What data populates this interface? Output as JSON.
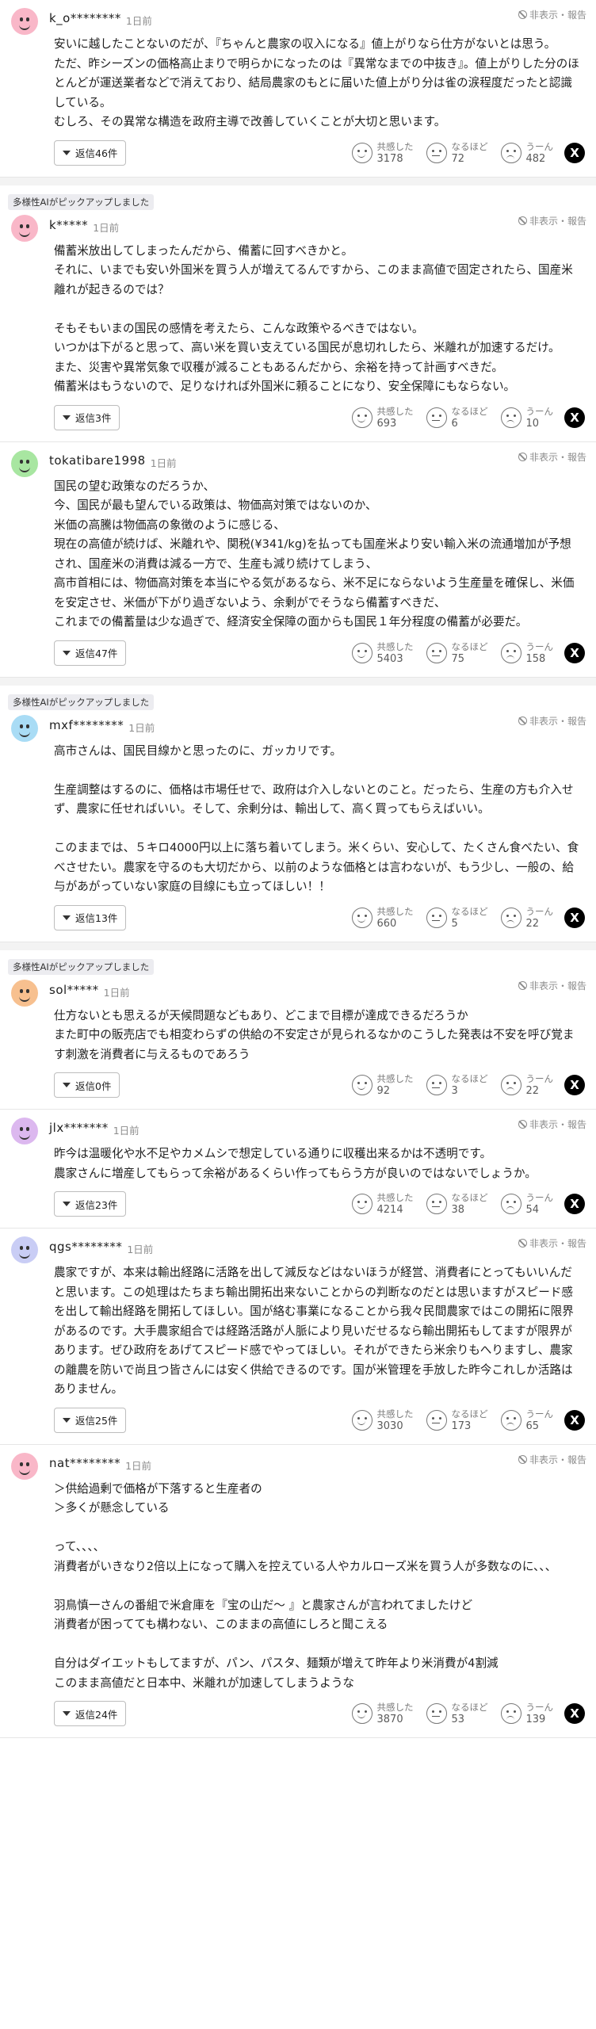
{
  "labels": {
    "report": "非表示・報告",
    "pickup_badge": "多様性AIがピックアップしました",
    "react_agree": "共感した",
    "react_insight": "なるほど",
    "react_hmm": "うーん",
    "x_share": "X"
  },
  "comments": [
    {
      "user": "k_o********",
      "time": "1日前",
      "picked": false,
      "avatar_color": "#f9b7c8",
      "lines": [
        "安いに越したことないのだが、『ちゃんと農家の収入になる』値上がりなら仕方がないとは思う。",
        "ただ、昨シーズンの価格高止まりで明らかになったのは『異常なまでの中抜き』。値上がりした分のほとんどが運送業者などで消えており、結局農家のもとに届いた値上がり分は雀の涙程度だったと認識している。",
        "むしろ、その異常な構造を政府主導で改善していくことが大切と思います。"
      ],
      "reply_label": "返信46件",
      "agree": "3178",
      "insight": "72",
      "hmm": "482"
    },
    {
      "user": "k*****",
      "time": "1日前",
      "picked": true,
      "avatar_color": "#f9b7c8",
      "lines": [
        "備蓄米放出してしまったんだから、備蓄に回すべきかと。",
        "それに、いまでも安い外国米を買う人が増えてるんですから、このまま高値で固定されたら、国産米離れが起きるのでは？",
        "",
        "そもそもいまの国民の感情を考えたら、こんな政策やるべきではない。",
        "いつかは下がると思って、高い米を買い支えている国民が息切れしたら、米離れが加速するだけ。",
        "また、災害や異常気象で収穫が減ることもあるんだから、余裕を持って計画すべきだ。",
        "備蓄米はもうないので、足りなければ外国米に頼ることになり、安全保障にもならない。"
      ],
      "reply_label": "返信3件",
      "agree": "693",
      "insight": "6",
      "hmm": "10"
    },
    {
      "user": "tokatibare1998",
      "time": "1日前",
      "picked": false,
      "avatar_color": "#a8e6a1",
      "lines": [
        "国民の望む政策なのだろうか、",
        "今、国民が最も望んでいる政策は、物価高対策ではないのか、",
        "米価の高騰は物価高の象徴のように感じる、",
        "現在の高値が続けば、米離れや、関税(¥341/kg)を払っても国産米より安い輸入米の流通増加が予想され、国産米の消費は減る一方で、生産も減り続けてしまう、",
        "高市首相には、物価高対策を本当にやる気があるなら、米不足にならないよう生産量を確保し、米価を安定させ、米価が下がり過ぎないよう、余剰がでそうなら備蓄すべきだ、",
        "これまでの備蓄量は少な過ぎで、経済安全保障の面からも国民１年分程度の備蓄が必要だ。"
      ],
      "reply_label": "返信47件",
      "agree": "5403",
      "insight": "75",
      "hmm": "158"
    },
    {
      "user": "mxf********",
      "time": "1日前",
      "picked": true,
      "avatar_color": "#a9dcf5",
      "lines": [
        "高市さんは、国民目線かと思ったのに、ガッカリです。",
        "",
        "生産調整はするのに、価格は市場任せで、政府は介入しないとのこと。だったら、生産の方も介入せず、農家に任せればいい。そして、余剰分は、輸出して、高く買ってもらえばいい。",
        "",
        "このままでは、５キロ4000円以上に落ち着いてしまう。米くらい、安心して、たくさん食べたい、食べさせたい。農家を守るのも大切だから、以前のような価格とは言わないが、もう少し、一般の、給与があがっていない家庭の目線にも立ってほしい！！"
      ],
      "reply_label": "返信13件",
      "agree": "660",
      "insight": "5",
      "hmm": "22"
    },
    {
      "user": "sol*****",
      "time": "1日前",
      "picked": true,
      "avatar_color": "#f7c08f",
      "lines": [
        "仕方ないとも思えるが天候問題などもあり、どこまで目標が達成できるだろうか",
        "また町中の販売店でも相変わらずの供給の不安定さが見られるなかのこうした発表は不安を呼び覚ます刺激を消費者に与えるものであろう"
      ],
      "reply_label": "返信0件",
      "agree": "92",
      "insight": "3",
      "hmm": "22"
    },
    {
      "user": "jlx*******",
      "time": "1日前",
      "picked": false,
      "avatar_color": "#dcb8ef",
      "lines": [
        "昨今は温暖化や水不足やカメムシで想定している通りに収穫出来るかは不透明です。",
        "農家さんに増産してもらって余裕があるくらい作ってもらう方が良いのではないでしょうか。"
      ],
      "reply_label": "返信23件",
      "agree": "4214",
      "insight": "38",
      "hmm": "54"
    },
    {
      "user": "qgs********",
      "time": "1日前",
      "picked": false,
      "avatar_color": "#c9cdf5",
      "lines": [
        "農家ですが、本来は輸出経路に活路を出して減反などはないほうが経営、消費者にとってもいいんだと思います。この処理はたちまち輸出開拓出来ないことからの判断なのだとは思いますがスピード感を出して輸出経路を開拓してほしい。国が絡む事業になることから我々民間農家ではこの開拓に限界があるのです。大手農家組合では経路活路が人脈により見いだせるなら輸出開拓もしてますが限界があります。ぜひ政府をあげてスピード感でやってほしい。それができたら米余りもへりますし、農家の離農を防いで尚且つ皆さんには安く供給できるのです。国が米管理を手放した昨今これしか活路はありません。"
      ],
      "reply_label": "返信25件",
      "agree": "3030",
      "insight": "173",
      "hmm": "65"
    },
    {
      "user": "nat********",
      "time": "1日前",
      "picked": false,
      "avatar_color": "#f9b7c8",
      "lines": [
        "＞供給過剰で価格が下落すると生産者の",
        "＞多くが懸念している",
        "",
        "って、、、、",
        "消費者がいきなり2倍以上になって購入を控えている人やカルローズ米を買う人が多数なのに、、、",
        "",
        "羽鳥慎一さんの番組で米倉庫を『宝の山だ〜 』と農家さんが言われてましたけど",
        "消費者が困ってても構わない、このままの高値にしろと聞こえる",
        "",
        "自分はダイエットもしてますが、パン、パスタ、麺類が増えて昨年より米消費が4割減",
        "このまま高値だと日本中、米離れが加速してしまうような"
      ],
      "reply_label": "返信24件",
      "agree": "3870",
      "insight": "53",
      "hmm": "139"
    }
  ]
}
